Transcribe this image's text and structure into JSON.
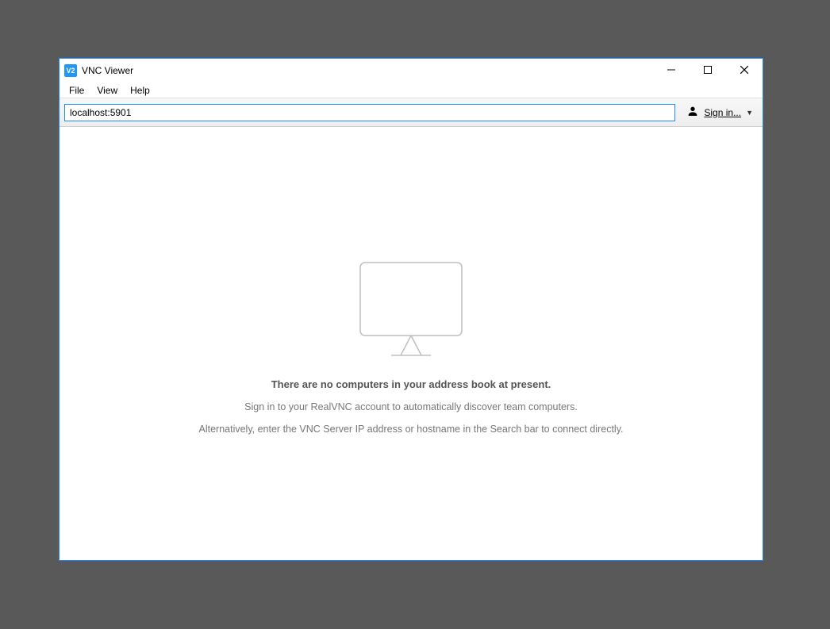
{
  "window": {
    "app_icon_label": "V2",
    "title": "VNC Viewer"
  },
  "menubar": {
    "items": [
      "File",
      "View",
      "Help"
    ]
  },
  "toolbar": {
    "address_value": "localhost:5901",
    "signin_label": "Sign in..."
  },
  "content": {
    "headline": "There are no computers in your address book at present.",
    "line1": "Sign in to your RealVNC account to automatically discover team computers.",
    "line2": "Alternatively, enter the VNC Server IP address or hostname in the Search bar to connect directly."
  }
}
